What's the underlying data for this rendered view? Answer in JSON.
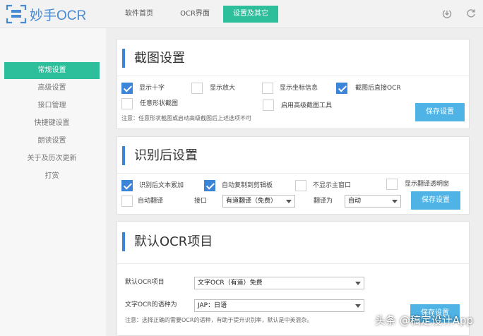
{
  "app": {
    "logo_text": "妙手OCR"
  },
  "nav": {
    "tabs": [
      {
        "label": "软件首页"
      },
      {
        "label": "OCR界面"
      },
      {
        "label": "设置及其它"
      }
    ]
  },
  "sidebar": {
    "items": [
      {
        "label": "常规设置"
      },
      {
        "label": "高级设置"
      },
      {
        "label": "接口管理"
      },
      {
        "label": "快捷键设置"
      },
      {
        "label": "朗读设置"
      },
      {
        "label": "关于及历次更新"
      },
      {
        "label": "打赏"
      }
    ]
  },
  "screenshot_settings": {
    "title": "截图设置",
    "options": [
      {
        "label": "显示十字",
        "checked": true
      },
      {
        "label": "显示放大",
        "checked": false
      },
      {
        "label": "显示坐标信息",
        "checked": false
      },
      {
        "label": "截图后直接OCR",
        "checked": true
      },
      {
        "label": "任意形状截图",
        "checked": false
      },
      {
        "label": "启用高级截图工具",
        "checked": false
      }
    ],
    "note": "注意：任意形状截图或启动高级截图后上述选项不可",
    "save_label": "保存设置"
  },
  "post_recognition": {
    "title": "识别后设置",
    "options": [
      {
        "label": "识别后文本累加",
        "checked": true
      },
      {
        "label": "自动复制到剪辑板",
        "checked": true
      },
      {
        "label": "不显示主窗口",
        "checked": false
      },
      {
        "label": "显示翻译透明窗",
        "checked": false
      },
      {
        "label": "自动翻译",
        "checked": false
      }
    ],
    "interface_label": "接口",
    "interface_value": "有道翻译（免费）",
    "translate_to_label": "翻译为",
    "translate_to_value": "自动",
    "save_label": "保存设置"
  },
  "default_ocr": {
    "title": "默认OCR项目",
    "project_label": "默认OCR项目",
    "project_value": "文字OCR（有道）免费",
    "language_label": "文字OCR的语种为",
    "language_value": "JAP：日语",
    "note": "注意：选择正确的需要OCR的语种，有助于提升识别率，默认是中英混杂。",
    "save_label": "保存设置"
  },
  "watermark": "头条 @稿定设计App",
  "colors": {
    "accent_green": "#2dbe9b",
    "accent_blue": "#3b84d8",
    "button_blue": "#4fb3e6"
  }
}
